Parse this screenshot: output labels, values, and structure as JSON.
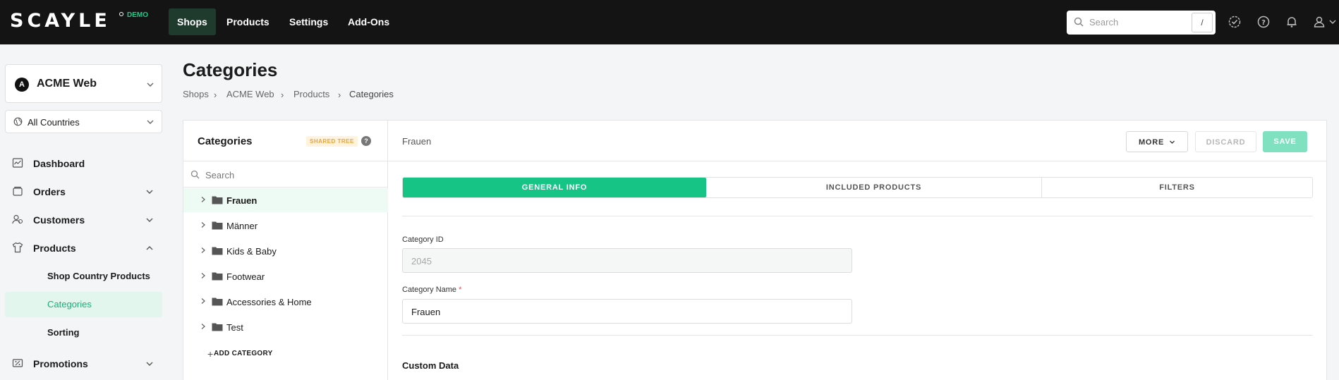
{
  "brand": {
    "logo": "SCAYLE",
    "badge": "DEMO"
  },
  "topnav": {
    "items": [
      {
        "label": "Shops",
        "active": true
      },
      {
        "label": "Products",
        "active": false
      },
      {
        "label": "Settings",
        "active": false
      },
      {
        "label": "Add-Ons",
        "active": false
      }
    ],
    "search": {
      "placeholder": "Search",
      "shortcut": "/"
    },
    "icons": [
      "tasks-icon",
      "help-icon",
      "bell-icon",
      "user-icon"
    ]
  },
  "sidebar": {
    "shop": {
      "logo_letter": "A",
      "name": "ACME Web"
    },
    "country": {
      "name": "All Countries"
    },
    "items": [
      {
        "label": "Dashboard",
        "icon": "dashboard-icon"
      },
      {
        "label": "Orders",
        "icon": "orders-icon"
      },
      {
        "label": "Customers",
        "icon": "customers-icon"
      },
      {
        "label": "Products",
        "icon": "shirt-icon"
      },
      {
        "label": "Promotions",
        "icon": "promotions-icon"
      }
    ],
    "product_sub": [
      {
        "label": "Shop Country Products",
        "active": false
      },
      {
        "label": "Categories",
        "active": true
      },
      {
        "label": "Sorting",
        "active": false
      }
    ]
  },
  "page": {
    "title": "Categories",
    "breadcrumb": [
      "Shops",
      "ACME Web",
      "Products",
      "Categories"
    ]
  },
  "tree": {
    "title": "Categories",
    "badge": "SHARED TREE",
    "help": "?",
    "search_placeholder": "Search",
    "items": [
      {
        "label": "Frauen",
        "active": true
      },
      {
        "label": "Männer",
        "active": false
      },
      {
        "label": "Kids & Baby",
        "active": false
      },
      {
        "label": "Footwear",
        "active": false
      },
      {
        "label": "Accessories & Home",
        "active": false
      },
      {
        "label": "Test",
        "active": false
      }
    ],
    "add_label": "ADD CATEGORY"
  },
  "detail": {
    "title": "Frauen",
    "buttons": {
      "more": "MORE",
      "discard": "DISCARD",
      "save": "SAVE"
    },
    "tabs": [
      {
        "label": "GENERAL INFO",
        "active": true
      },
      {
        "label": "INCLUDED PRODUCTS",
        "active": false
      },
      {
        "label": "FILTERS",
        "active": false
      }
    ],
    "fields": {
      "category_id": {
        "label": "Category ID",
        "value": "2045"
      },
      "category_name": {
        "label": "Category Name",
        "required": "*",
        "value": "Frauen"
      }
    },
    "section": "Custom Data"
  },
  "colors": {
    "accent": "#16c486",
    "topbar": "#141414",
    "badge_bg": "#fff3de",
    "badge_text": "#e8a441"
  }
}
